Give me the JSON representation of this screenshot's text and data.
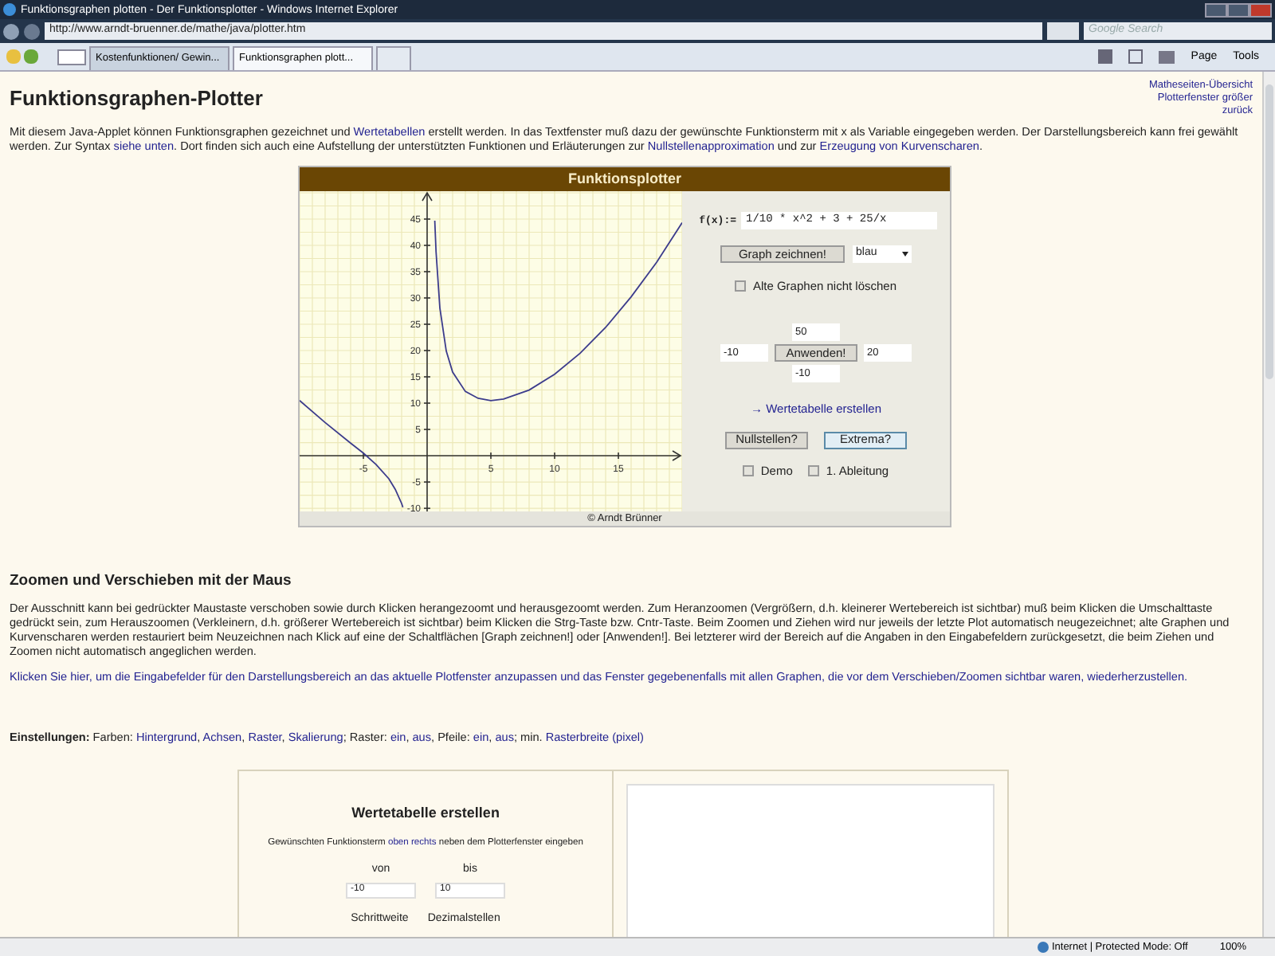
{
  "window": {
    "title": "Funktionsgraphen plotten - Der Funktionsplotter - Windows Internet Explorer"
  },
  "address_bar": {
    "url": "http://www.arndt-bruenner.de/mathe/java/plotter.htm"
  },
  "search": {
    "placeholder": "Google Search"
  },
  "tabs": [
    {
      "label": "Kostenfunktionen/ Gewin...",
      "selected": false
    },
    {
      "label": "Funktionsgraphen plott...",
      "selected": true
    }
  ],
  "toolbar": {
    "page": "Page",
    "tools": "Tools"
  },
  "page": {
    "heading": "Funktionsgraphen-Plotter",
    "top_links": [
      "Matheseiten-Übersicht",
      "Plotterfenster größer",
      "zurück"
    ],
    "intro": [
      {
        "text": "Mit diesem Java-Applet können Funktionsgraphen gezeichnet und ",
        "link": false
      },
      {
        "text": "Wertetabellen",
        "link": true
      },
      {
        "text": " erstellt werden. In das Textfenster muß dazu der gewünschte Funktionsterm mit x als Variable eingegeben werden. Der Darstellungsbereich kann frei gewählt werden. Zur Syntax ",
        "link": false
      },
      {
        "text": "siehe unten",
        "link": true
      },
      {
        "text": ". Dort finden sich auch eine Aufstellung der unterstützten Funktionen und Erläuterungen zur ",
        "link": false
      },
      {
        "text": "Nullstellenapproximation",
        "link": true
      },
      {
        "text": " und zur ",
        "link": false
      },
      {
        "text": "Erzeugung von Kurvenscharen",
        "link": true
      },
      {
        "text": ".",
        "link": false
      }
    ],
    "applet": {
      "title": "Funktionsplotter",
      "chart_data": {
        "type": "line",
        "grid": true,
        "x": [
          -10,
          -8,
          -6,
          -5,
          -4,
          -3,
          -2.5,
          -2,
          -1.9,
          0,
          0.6,
          0.7,
          1,
          1.5,
          2,
          3,
          4,
          5,
          6,
          8,
          10,
          12,
          14,
          16,
          18,
          20
        ],
        "series": [
          {
            "color": "#3c3c8c",
            "values": [
              10.5,
              6.3,
              2.4,
              0.5,
              -1.7,
              -4.4,
              -6.4,
              -9.1,
              -9.8,
              null,
              44.7,
              38.8,
              28.1,
              19.9,
              15.9,
              12.2,
              10.9,
              10.5,
              10.8,
              12.5,
              15.5,
              19.5,
              24.4,
              30.2,
              36.8,
              44.3
            ]
          }
        ],
        "xlim": [
          -10,
          20
        ],
        "ylim": [
          -10.6,
          50.3
        ],
        "xticks": [
          -5,
          5,
          10,
          15
        ],
        "yticks": [
          -10,
          -5,
          5,
          10,
          15,
          20,
          25,
          30,
          35,
          40,
          45
        ]
      },
      "function_label": "f(x):=",
      "function_value": "1/10 * x^2 + 3 + 25/x",
      "draw_button": "Graph zeichnen!",
      "color_select": "blau",
      "keep_graphs": {
        "label": "Alte Graphen nicht löschen",
        "checked": false
      },
      "y_max": "50",
      "x_min": "-10",
      "apply_button": "Anwenden!",
      "x_max": "20",
      "y_min": "-10",
      "table_link": "→ Wertetabelle erstellen",
      "buttons": [
        {
          "label": "Nullstellen?",
          "focused": false
        },
        {
          "label": "Extrema?",
          "focused": true
        }
      ],
      "options": [
        {
          "label": "Demo",
          "checked": false
        },
        {
          "label": "1. Ableitung",
          "checked": false
        }
      ],
      "footer": "© Arndt Brünner"
    },
    "section_heading": "Zoomen und Verschieben mit der Maus",
    "section_text": "Der Ausschnitt kann bei gedrückter Maustaste verschoben sowie durch Klicken herangezoomt und herausgezoomt werden. Zum Heranzoomen (Vergrößern, d.h. kleinerer Wertebereich ist sichtbar) muß beim Klicken die Umschalttaste gedrückt sein, zum Herauszoomen (Verkleinern, d.h. größerer Wertebereich ist sichtbar) beim Klicken die Strg-Taste bzw. Cntr-Taste. Beim Zoomen und Ziehen wird nur jeweils der letzte Plot automatisch neugezeichnet; alte Graphen und Kurvenscharen werden restauriert beim Neuzeichnen nach Klick auf eine der Schaltflächen [Graph zeichnen!] oder [Anwenden!]. Bei letzterer wird der Bereich auf die Angaben in den Eingabefeldern zurückgesetzt, die beim Ziehen und Zoomen nicht automatisch angeglichen werden.",
    "restore_link": "Klicken Sie hier, um die Eingabefelder für den Darstellungsbereich an das aktuelle Plotfenster anzupassen und das Fenster gegebenenfalls mit allen Graphen, die vor dem Verschieben/Zoomen sichtbar waren, wiederherzustellen.",
    "settings": [
      {
        "text": "Einstellungen:",
        "link": false,
        "bold": true
      },
      {
        "text": " Farben: ",
        "link": false,
        "bold": false
      },
      {
        "text": "Hintergrund",
        "link": true,
        "bold": false
      },
      {
        "text": ", ",
        "link": false,
        "bold": false
      },
      {
        "text": "Achsen",
        "link": true,
        "bold": false
      },
      {
        "text": ", ",
        "link": false,
        "bold": false
      },
      {
        "text": "Raster",
        "link": true,
        "bold": false
      },
      {
        "text": ", ",
        "link": false,
        "bold": false
      },
      {
        "text": "Skalierung",
        "link": true,
        "bold": false
      },
      {
        "text": "; Raster: ",
        "link": false,
        "bold": false
      },
      {
        "text": "ein",
        "link": true,
        "bold": false
      },
      {
        "text": ", ",
        "link": false,
        "bold": false
      },
      {
        "text": "aus",
        "link": true,
        "bold": false
      },
      {
        "text": ", Pfeile: ",
        "link": false,
        "bold": false
      },
      {
        "text": "ein",
        "link": true,
        "bold": false
      },
      {
        "text": ", ",
        "link": false,
        "bold": false
      },
      {
        "text": "aus",
        "link": true,
        "bold": false
      },
      {
        "text": "; min. ",
        "link": false,
        "bold": false
      },
      {
        "text": "Rasterbreite (pixel)",
        "link": true,
        "bold": false
      }
    ],
    "table_panel": {
      "title": "Wertetabelle erstellen",
      "hint": [
        {
          "text": "Gewünschten Funktionsterm ",
          "link": false
        },
        {
          "text": "oben rechts",
          "link": true
        },
        {
          "text": " neben dem Plotterfenster eingeben",
          "link": false
        }
      ],
      "from_label": "von",
      "to_label": "bis",
      "from_value": "-10",
      "to_value": "10",
      "step_label": "Schrittweite",
      "decimals_label": "Dezimalstellen"
    }
  },
  "status_bar": {
    "zone": "Internet | Protected Mode: Off",
    "zoom": "100%"
  }
}
